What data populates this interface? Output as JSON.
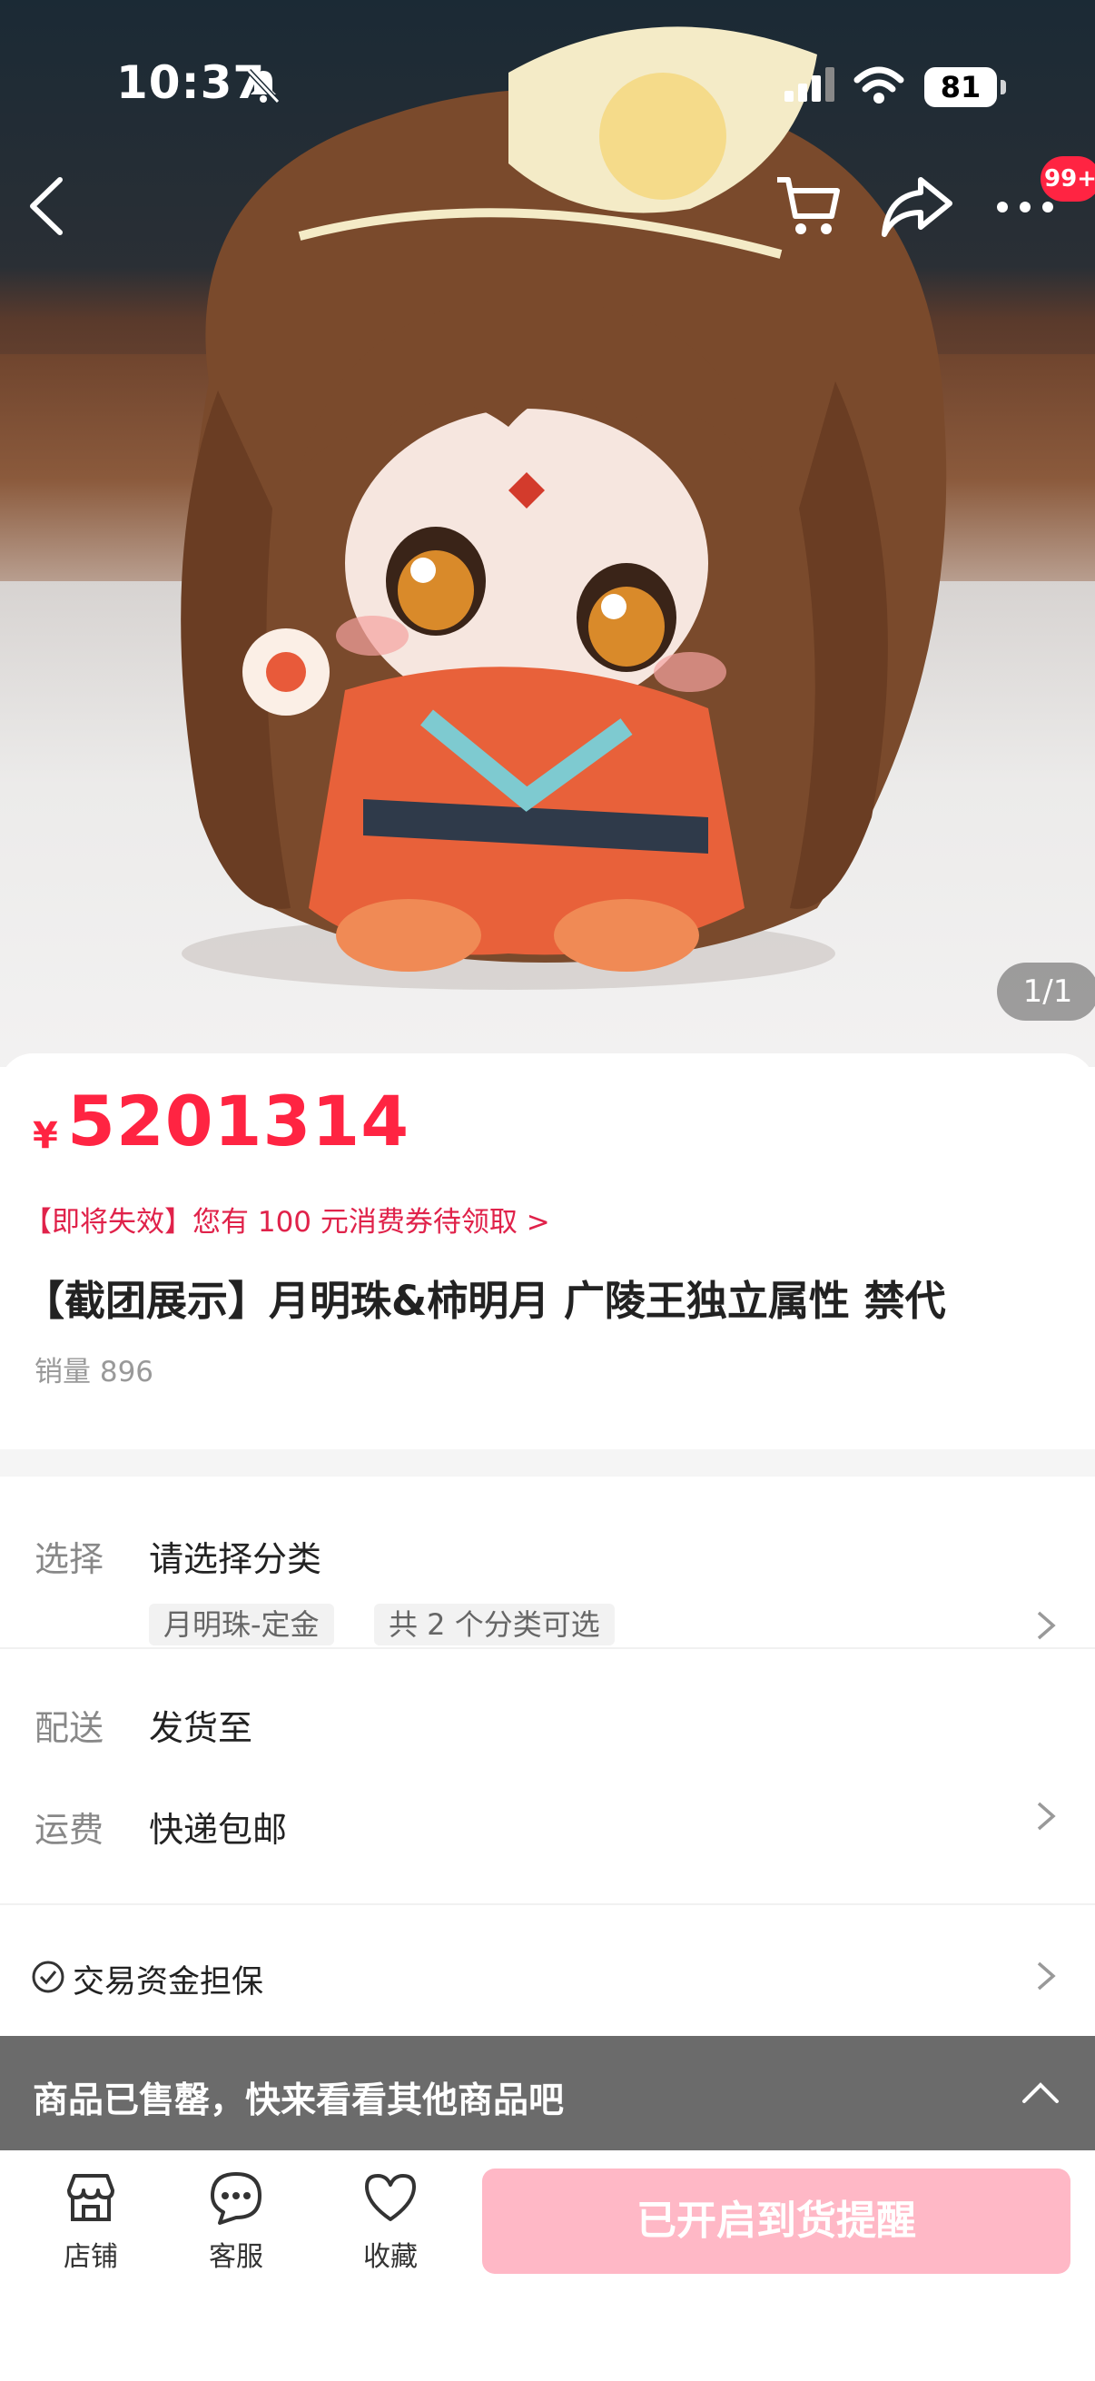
{
  "status_bar": {
    "time": "10:37",
    "battery": "81"
  },
  "nav": {
    "badge": "99+",
    "image_counter": "1/1"
  },
  "product": {
    "price_symbol": "¥",
    "price": "5201314",
    "coupon": "【即将失效】您有 100 元消费券待领取 >",
    "title": "【截团展示】月明珠&柿明月 广陵王独立属性 禁代",
    "sales": "销量 896"
  },
  "options": {
    "select_label": "选择",
    "select_value": "请选择分类",
    "chip1": "月明珠-定金",
    "chip2": "共 2 个分类可选",
    "delivery_label": "配送",
    "delivery_value": "发货至",
    "shipping_label": "运费",
    "shipping_value": "快递包邮"
  },
  "guarantee": {
    "text": "交易资金担保"
  },
  "soldout": {
    "text": "商品已售罄，快来看看其他商品吧"
  },
  "bottom_bar": {
    "store": "店铺",
    "service": "客服",
    "favorite": "收藏",
    "remind_button": "已开启到货提醒"
  },
  "colors": {
    "accent": "#ff2442",
    "remind_button_bg": "#ffb8c6",
    "banner_bg": "#6b6b6b"
  }
}
